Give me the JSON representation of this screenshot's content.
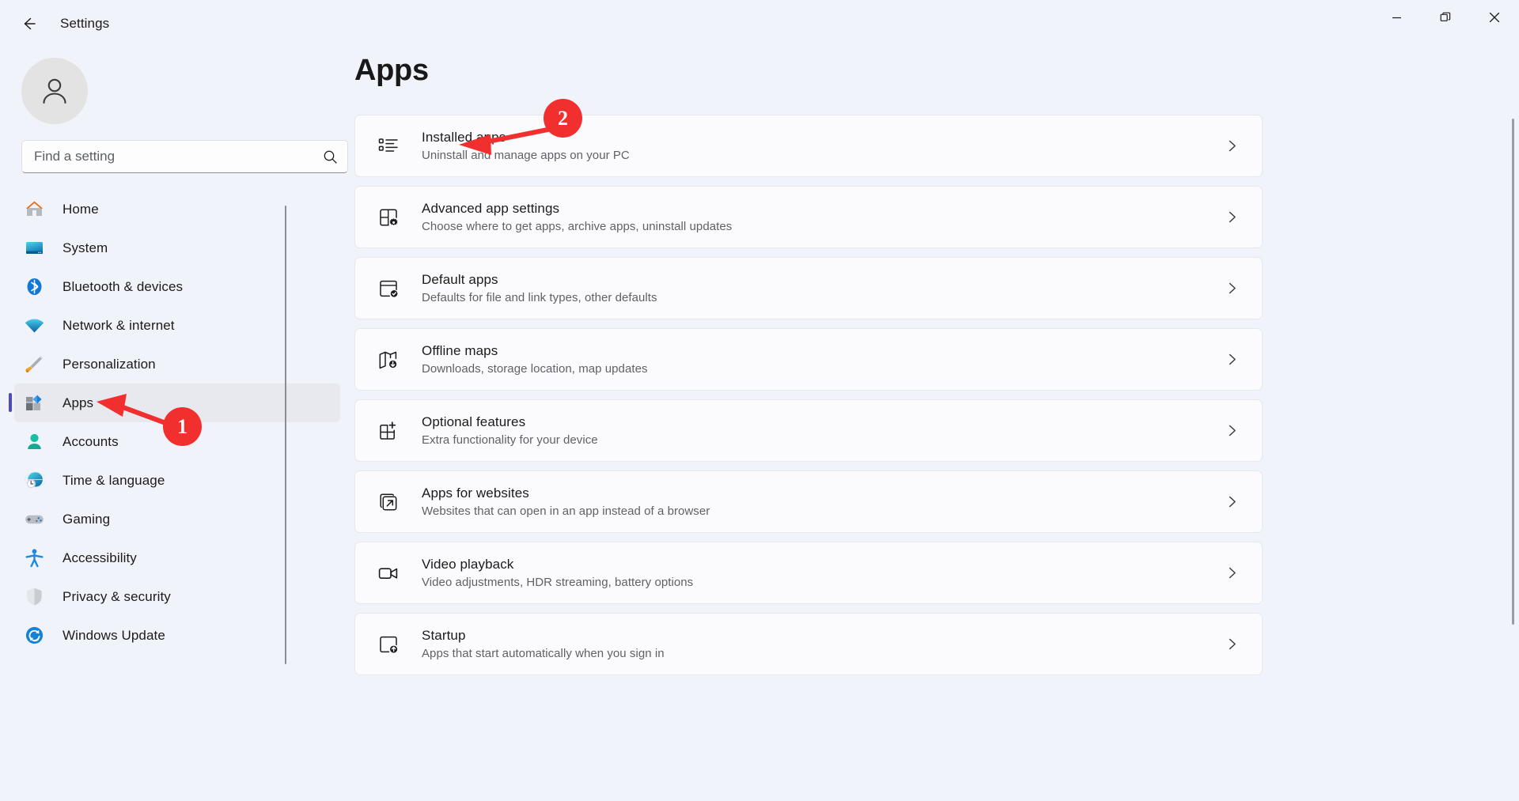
{
  "window": {
    "title": "Settings",
    "back_icon": "back-arrow-icon",
    "controls": {
      "minimize": "minimize-icon",
      "maximize": "maximize-restore-icon",
      "close": "close-icon"
    }
  },
  "sidebar": {
    "avatar_icon": "person-avatar-icon",
    "search": {
      "placeholder": "Find a setting",
      "value": "",
      "icon": "search-icon"
    },
    "items": [
      {
        "label": "Home",
        "icon": "home-icon",
        "selected": false
      },
      {
        "label": "System",
        "icon": "system-monitor-icon",
        "selected": false
      },
      {
        "label": "Bluetooth & devices",
        "icon": "bluetooth-icon",
        "selected": false
      },
      {
        "label": "Network & internet",
        "icon": "wifi-icon",
        "selected": false
      },
      {
        "label": "Personalization",
        "icon": "paintbrush-icon",
        "selected": false
      },
      {
        "label": "Apps",
        "icon": "apps-tiles-icon",
        "selected": true
      },
      {
        "label": "Accounts",
        "icon": "account-person-icon",
        "selected": false
      },
      {
        "label": "Time & language",
        "icon": "globe-clock-icon",
        "selected": false
      },
      {
        "label": "Gaming",
        "icon": "gamepad-icon",
        "selected": false
      },
      {
        "label": "Accessibility",
        "icon": "accessibility-person-icon",
        "selected": false
      },
      {
        "label": "Privacy & security",
        "icon": "shield-icon",
        "selected": false
      },
      {
        "label": "Windows Update",
        "icon": "update-refresh-icon",
        "selected": false
      }
    ]
  },
  "main": {
    "title": "Apps",
    "cards": [
      {
        "title": "Installed apps",
        "subtitle": "Uninstall and manage apps on your PC",
        "icon": "bullet-list-icon",
        "chevron": "chevron-right-icon"
      },
      {
        "title": "Advanced app settings",
        "subtitle": "Choose where to get apps, archive apps, uninstall updates",
        "icon": "app-window-gear-icon",
        "chevron": "chevron-right-icon"
      },
      {
        "title": "Default apps",
        "subtitle": "Defaults for file and link types, other defaults",
        "icon": "window-check-icon",
        "chevron": "chevron-right-icon"
      },
      {
        "title": "Offline maps",
        "subtitle": "Downloads, storage location, map updates",
        "icon": "map-download-icon",
        "chevron": "chevron-right-icon"
      },
      {
        "title": "Optional features",
        "subtitle": "Extra functionality for your device",
        "icon": "grid-plus-icon",
        "chevron": "chevron-right-icon"
      },
      {
        "title": "Apps for websites",
        "subtitle": "Websites that can open in an app instead of a browser",
        "icon": "open-external-icon",
        "chevron": "chevron-right-icon"
      },
      {
        "title": "Video playback",
        "subtitle": "Video adjustments, HDR streaming, battery options",
        "icon": "video-camera-icon",
        "chevron": "chevron-right-icon"
      },
      {
        "title": "Startup",
        "subtitle": "Apps that start automatically when you sign in",
        "icon": "startup-window-up-icon",
        "chevron": "chevron-right-icon"
      }
    ]
  },
  "annotations": {
    "accent_color": "#f22f2f",
    "markers": [
      {
        "number": "1",
        "points_at": "sidebar-item-apps"
      },
      {
        "number": "2",
        "points_at": "card-installed-apps"
      }
    ]
  }
}
